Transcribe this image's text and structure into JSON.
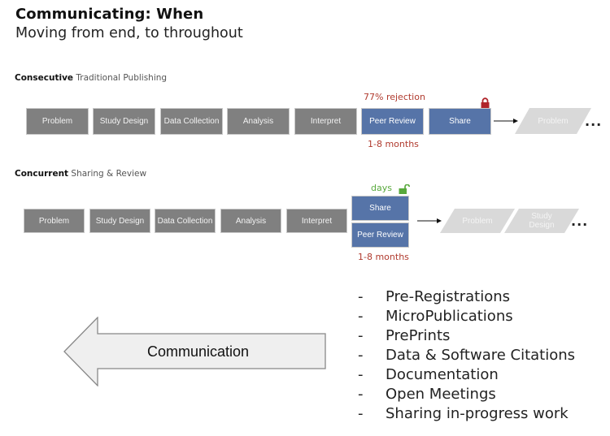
{
  "header": {
    "title": "Communicating: When",
    "subtitle": "Moving from end, to throughout"
  },
  "consecutive": {
    "label_bold": "Consecutive",
    "label_rest": " Traditional Publishing",
    "steps": [
      "Problem",
      "Study Design",
      "Data Collection",
      "Analysis",
      "Interpret"
    ],
    "peer_review": "Peer Review",
    "share": "Share",
    "rejection_note": "77% rejection",
    "duration_note": "1-8 months",
    "lock_icon": "lock-closed-icon",
    "next_step": "Problem",
    "ellipsis": "..."
  },
  "concurrent": {
    "label_bold": "Concurrent",
    "label_rest": " Sharing & Review",
    "steps": [
      "Problem",
      "Study Design",
      "Data Collection",
      "Analysis",
      "Interpret"
    ],
    "share": "Share",
    "peer_review": "Peer Review",
    "days_note": "days",
    "duration_note": "1-8 months",
    "lock_icon": "lock-open-icon",
    "next_steps": [
      "Problem",
      "Study Design"
    ],
    "ellipsis": "..."
  },
  "communication_arrow": {
    "label": "Communication"
  },
  "list": {
    "bullet": "-",
    "items": [
      "Pre-Registrations",
      "MicroPublications",
      "PrePrints",
      "Data & Software Citations",
      "Documentation",
      "Open Meetings",
      "Sharing in-progress work"
    ]
  },
  "colors": {
    "step_gray": "#808080",
    "step_blue": "#5674a8",
    "future_gray": "#d9d9d9",
    "red_note": "#b03a2e",
    "green_note": "#58a93c",
    "lock_red": "#b0242a"
  }
}
